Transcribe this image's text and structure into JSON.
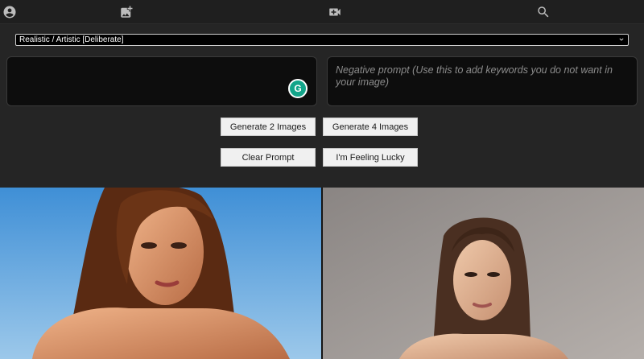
{
  "nav": {
    "tabs": [
      {
        "id": "profile",
        "icon": "account-circle-icon"
      },
      {
        "id": "image",
        "icon": "add-photo-icon",
        "active": true
      },
      {
        "id": "video",
        "icon": "video-add-icon"
      },
      {
        "id": "search",
        "icon": "search-icon"
      }
    ]
  },
  "model_select": {
    "value": "Realistic / Artistic [Deliberate]"
  },
  "prompt": {
    "value": ""
  },
  "negative_prompt": {
    "placeholder": "Negative prompt (Use this to add keywords you do not want in your image)"
  },
  "buttons": {
    "generate2": "Generate 2 Images",
    "generate4": "Generate 4 Images",
    "clear": "Clear Prompt",
    "lucky": "I'm Feeling Lucky"
  },
  "gallery": {
    "images": [
      {
        "background": "sky-blue"
      },
      {
        "background": "neutral-gray"
      }
    ]
  },
  "colors": {
    "page_bg": "#252525",
    "topbar_bg": "#1f1f1f",
    "textarea_bg": "#0d0d0d",
    "button_bg": "#f0f0f0",
    "grammarly": "#13a58a"
  }
}
